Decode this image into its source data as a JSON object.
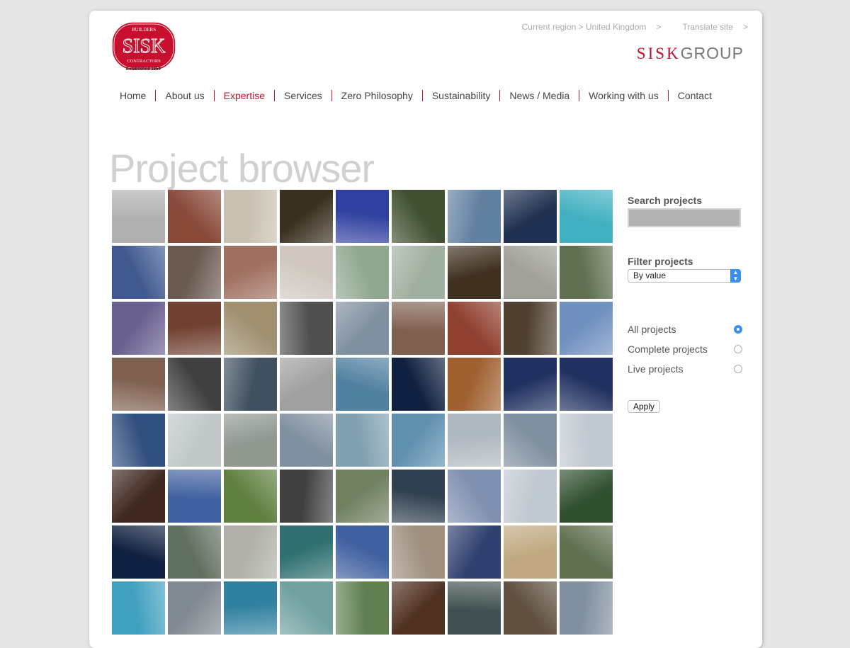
{
  "header": {
    "logo": {
      "top": "BUILDERS",
      "main": "SISK",
      "bottom": "CONTRACTORS",
      "established": "Established 1859",
      "color": "#c8102e"
    },
    "region_link": "Current region > United Kingdom",
    "translate_link": "Translate site",
    "chevron": ">",
    "group_logo": {
      "sisk": "SISK",
      "group": "GROUP"
    }
  },
  "nav": {
    "items": [
      {
        "label": "Home"
      },
      {
        "label": "About us"
      },
      {
        "label": "Expertise",
        "active": true
      },
      {
        "label": "Services"
      },
      {
        "label": "Zero Philosophy"
      },
      {
        "label": "Sustainability"
      },
      {
        "label": "News / Media"
      },
      {
        "label": "Working with us"
      },
      {
        "label": "Contact"
      }
    ]
  },
  "page_title": "Project browser",
  "sidebar": {
    "search_label": "Search projects",
    "search_value": "",
    "filter_label": "Filter projects",
    "filter_selected": "By value",
    "radios": [
      {
        "label": "All projects",
        "checked": true
      },
      {
        "label": "Complete projects",
        "checked": false
      },
      {
        "label": "Live projects",
        "checked": false
      }
    ],
    "apply_label": "Apply"
  },
  "thumbnails": [
    "#b0b0b0",
    "#8a4a3a",
    "#c8c0b0",
    "#3a3020",
    "#3040a0",
    "#405030",
    "#6080a0",
    "#203050",
    "#40b0c0",
    "#405a90",
    "#6a5a50",
    "#a07060",
    "#d0c8c0",
    "#90a890",
    "#a0b0a0",
    "#403020",
    "#a0a098",
    "#607050",
    "#6a6090",
    "#704030",
    "#a09070",
    "#505050",
    "#8090a0",
    "#806050",
    "#904030",
    "#504030",
    "#7090c0",
    "#806050",
    "#404040",
    "#405060",
    "#a0a0a0",
    "#5080a0",
    "#102040",
    "#a06030",
    "#203060",
    "#203060",
    "#305080",
    "#c0c8c8",
    "#909890",
    "#8090a0",
    "#80a0b0",
    "#6090b0",
    "#b0b8c0",
    "#8090a0",
    "#c0c8d0",
    "#402820",
    "#4060a0",
    "#608040",
    "#404040",
    "#708060",
    "#304050",
    "#8090b0",
    "#c0c8d0",
    "#305030",
    "#102040",
    "#607060",
    "#b0b0a8",
    "#307070",
    "#4060a0",
    "#a09080",
    "#304070",
    "#c0a880",
    "#607050",
    "#40a0c0",
    "#808890",
    "#3080a0",
    "#70a0a0",
    "#608050",
    "#503020",
    "#405050",
    "#605040",
    "#8090a0"
  ]
}
